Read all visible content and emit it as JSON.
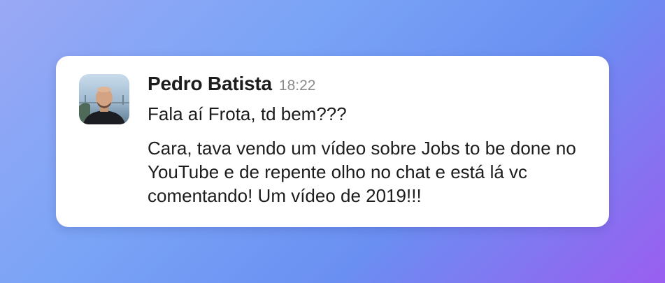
{
  "message": {
    "author": "Pedro Batista",
    "timestamp": "18:22",
    "avatar_icon": "user-avatar-photo",
    "lines": [
      "Fala aí Frota, td bem???",
      "Cara, tava vendo um vídeo sobre Jobs to be done no YouTube e de repente olho no chat e está lá vc comentando! Um vídeo de 2019!!!"
    ]
  },
  "colors": {
    "card_background": "#ffffff",
    "name_text": "#1d1c1d",
    "timestamp_text": "#8a8a8d"
  }
}
